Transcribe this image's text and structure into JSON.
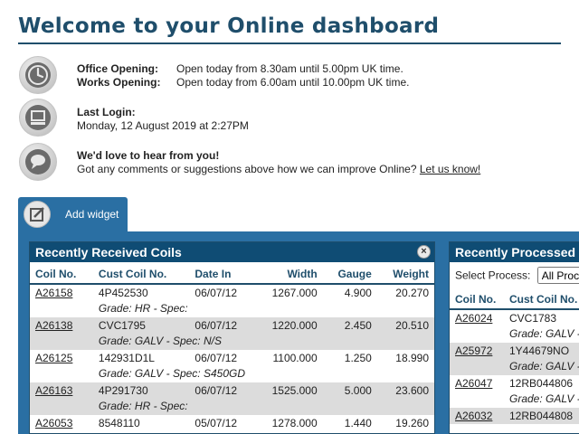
{
  "page": {
    "title": "Welcome to your Online dashboard"
  },
  "info": {
    "office_label": "Office Opening:",
    "office_text": "Open today from 8.30am until 5.00pm UK time.",
    "works_label": "Works Opening:",
    "works_text": "Open today from 6.00am until 10.00pm UK time.",
    "login_label": "Last Login:",
    "login_text": "Monday, 12 August 2019 at 2:27PM",
    "feedback_heading": "We'd love to hear from you!",
    "feedback_text": "Got any comments or suggestions above how we can improve Online?",
    "feedback_link": "Let us know!"
  },
  "icons": {
    "clock": "clock-icon",
    "computer": "computer-icon",
    "speech": "speech-bubble-icon",
    "edit": "edit-icon",
    "close": "close-icon"
  },
  "widgets": {
    "add_label": "Add widget"
  },
  "received": {
    "title": "Recently Received Coils",
    "close": "×",
    "columns": [
      "Coil No.",
      "Cust Coil No.",
      "Date In",
      "Width",
      "Gauge",
      "Weight"
    ],
    "rows": [
      {
        "coil": "A26158",
        "cust": "4P452530",
        "date": "06/07/12",
        "width": "1267.000",
        "gauge": "4.900",
        "weight": "20.270",
        "grade": "Grade: HR - Spec:"
      },
      {
        "coil": "A26138",
        "cust": "CVC1795",
        "date": "06/07/12",
        "width": "1220.000",
        "gauge": "2.450",
        "weight": "20.510",
        "grade": "Grade: GALV - Spec: N/S"
      },
      {
        "coil": "A26125",
        "cust": "142931D1L",
        "date": "06/07/12",
        "width": "1100.000",
        "gauge": "1.250",
        "weight": "18.990",
        "grade": "Grade: GALV - Spec: S450GD"
      },
      {
        "coil": "A26163",
        "cust": "4P291730",
        "date": "06/07/12",
        "width": "1525.000",
        "gauge": "5.000",
        "weight": "23.600",
        "grade": "Grade: HR - Spec:"
      },
      {
        "coil": "A26053",
        "cust": "8548110",
        "date": "05/07/12",
        "width": "1278.000",
        "gauge": "1.440",
        "weight": "19.260",
        "grade": ""
      }
    ]
  },
  "processed": {
    "title": "Recently Processed",
    "select_label": "Select Process:",
    "select_value": "All Proc",
    "columns": [
      "Coil No.",
      "Cust Coil No."
    ],
    "rows": [
      {
        "coil": "A26024",
        "cust": "CVC1783",
        "grade": "Grade: GALV -"
      },
      {
        "coil": "A25972",
        "cust": "1Y44679NO",
        "grade": "Grade: GALV -"
      },
      {
        "coil": "A26047",
        "cust": "12RB044806",
        "grade": "Grade: GALV -"
      },
      {
        "coil": "A26032",
        "cust": "12RB044808",
        "grade": ""
      }
    ]
  }
}
